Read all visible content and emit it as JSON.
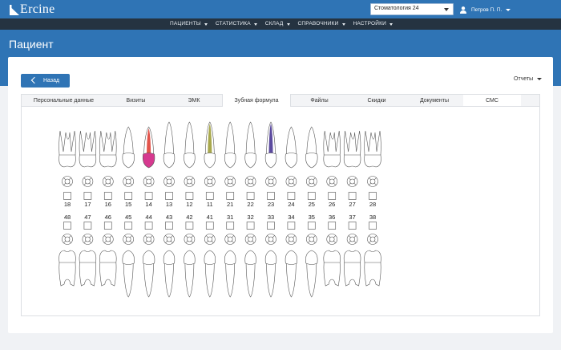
{
  "header": {
    "logo_text": "Ercine",
    "clinic_select": "Стоматология 24",
    "user_name": "Петров П. П."
  },
  "nav": {
    "items": [
      {
        "label": "ПАЦИЕНТЫ"
      },
      {
        "label": "СТАТИСТИКА"
      },
      {
        "label": "СКЛАД"
      },
      {
        "label": "СПРАВОЧНИКИ"
      },
      {
        "label": "НАСТРОЙКИ"
      }
    ]
  },
  "page": {
    "title": "Пациент",
    "back_label": "Назад",
    "reports_label": "Отчеты"
  },
  "tabs": [
    {
      "label": "Персональные данные",
      "active": false
    },
    {
      "label": "Визиты",
      "active": false
    },
    {
      "label": "ЭМК",
      "active": false
    },
    {
      "label": "Зубная формула",
      "active": true
    },
    {
      "label": "Файлы",
      "active": false
    },
    {
      "label": "Скидки",
      "active": false
    },
    {
      "label": "Документы",
      "active": false
    },
    {
      "label": "СМС",
      "active": false
    }
  ],
  "colors": {
    "primary": "#2f74b5",
    "navbar": "#253341",
    "tooth_14_crown": "#d6398f",
    "tooth_14_root": "#e2534a",
    "tooth_11_root": "#a8a84c",
    "tooth_23_root": "#5b4a9e"
  },
  "dental_chart": {
    "upper_teeth": [
      "18",
      "17",
      "16",
      "15",
      "14",
      "13",
      "12",
      "11",
      "21",
      "22",
      "23",
      "24",
      "25",
      "26",
      "27",
      "28"
    ],
    "lower_teeth": [
      "48",
      "47",
      "46",
      "45",
      "44",
      "43",
      "42",
      "41",
      "31",
      "32",
      "33",
      "34",
      "35",
      "36",
      "37",
      "38"
    ],
    "marked": [
      {
        "tooth": "14",
        "crown": "tooth_14_crown",
        "root": "tooth_14_root"
      },
      {
        "tooth": "11",
        "root": "tooth_11_root"
      },
      {
        "tooth": "23",
        "root": "tooth_23_root"
      }
    ]
  }
}
